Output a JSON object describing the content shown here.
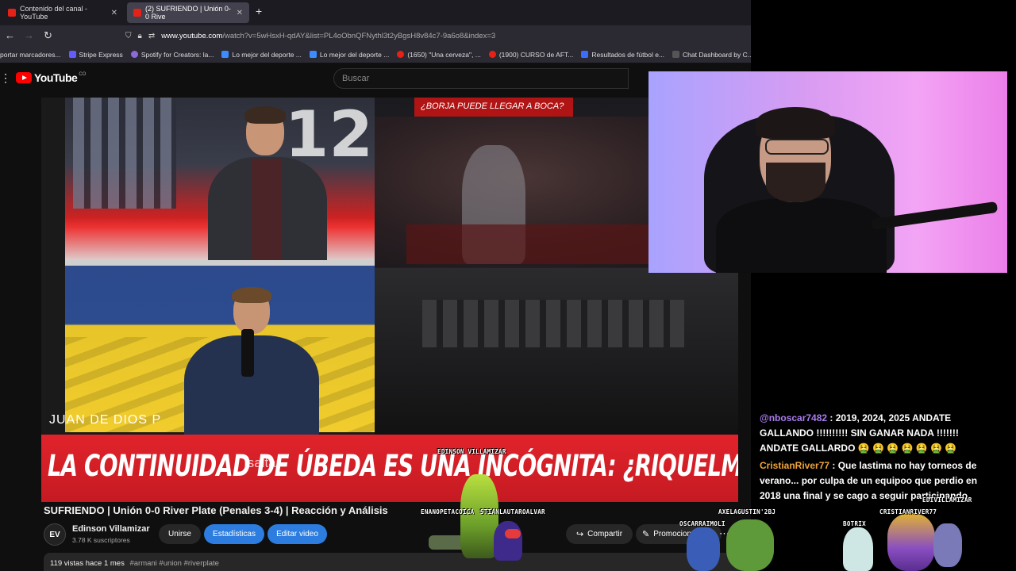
{
  "browser": {
    "tabs": [
      {
        "label": "Contenido del canal - YouTube"
      },
      {
        "label": "(2) SUFRIENDO | Unión 0-0 Rive"
      }
    ],
    "new_tab": "+",
    "url_domain": "www.youtube.com",
    "url_path": "/watch?v=5wHsxH-qdAY&list=PL4oObnQFNythl3t2yBgsH8v84c7-9a6o8&index=3",
    "bookmarks": [
      {
        "label": "portar marcadores...",
        "color": "#777777"
      },
      {
        "label": "Stripe Express",
        "color": "#635bff"
      },
      {
        "label": "Spotify for Creators: la...",
        "color": "#8c6bd6"
      },
      {
        "label": "Lo mejor del deporte ...",
        "color": "#3c8cff"
      },
      {
        "label": "Lo mejor del deporte ...",
        "color": "#3c8cff"
      },
      {
        "label": "(1650) \"Una cerveza\", ...",
        "color": "#e62117"
      },
      {
        "label": "(1900) CURSO de AFT...",
        "color": "#e62117"
      },
      {
        "label": "Resultados de fútbol e...",
        "color": "#3c6cff"
      },
      {
        "label": "Chat Dashboard by C...",
        "color": "#555555"
      }
    ]
  },
  "youtube": {
    "logo_text": "YouTube",
    "logo_country": "CO",
    "search_placeholder": "Buscar"
  },
  "video": {
    "right_question": "¿BORJA PUEDE LLEGAR A BOCA?",
    "name_card": "JUAN DE DIOS P",
    "banner_text": "LA CONTINUIDAD DE ÚBEDA ES UNA INCÓGNITA: ¿RIQUELME LO RATIFICARÁ?",
    "skip_label": "Isaltar",
    "title": "SUFRIENDO | Unión 0-0 River Plate (Penales 3-4) | Reacción y Análisis"
  },
  "channel": {
    "avatar_text": "EV",
    "name": "Edinson Villamizar",
    "subscribers": "3.78 K suscriptores",
    "join_label": "Unirse",
    "stats_label": "Estadísticas",
    "edit_label": "Editar video",
    "share_label": "Compartir",
    "promo_label": "Promociones",
    "more_label": "⋯"
  },
  "description": {
    "meta": "119 vistas  hace 1 mes",
    "tags": "#armani #union #riverplate"
  },
  "chat": [
    {
      "user": "@nboscar7482",
      "text": ": 2019, 2024, 2025 ANDATE GALLANDO !!!!!!!!!! SIN GANAR NADA !!!!!!! ANDATE GALLARDO 🤮 🤮 🤮 🤮 🤮 🤮 🤮"
    },
    {
      "user": "CristianRiver77",
      "text": ": Que lastima no hay torneos de verano... por culpa de un equipoo que perdio en 2018 una final y se cago a seguir participando"
    }
  ],
  "overlay_names": {
    "edinson_top": "EDINSON VILLAMIZAR",
    "enanopetacoi": "ENANOPETACOICA",
    "stianlautaro": "STIANLAUTAROALVAR",
    "axelagustin": "AXELAGUSTIN'2BJ",
    "oscarraimoli": "OSCARRAIMOLI",
    "edvillamizar": "EDIVILLAMIZAR",
    "botrix": "BOTRIX",
    "cristianriver": "CRISTIANRIVER77"
  }
}
